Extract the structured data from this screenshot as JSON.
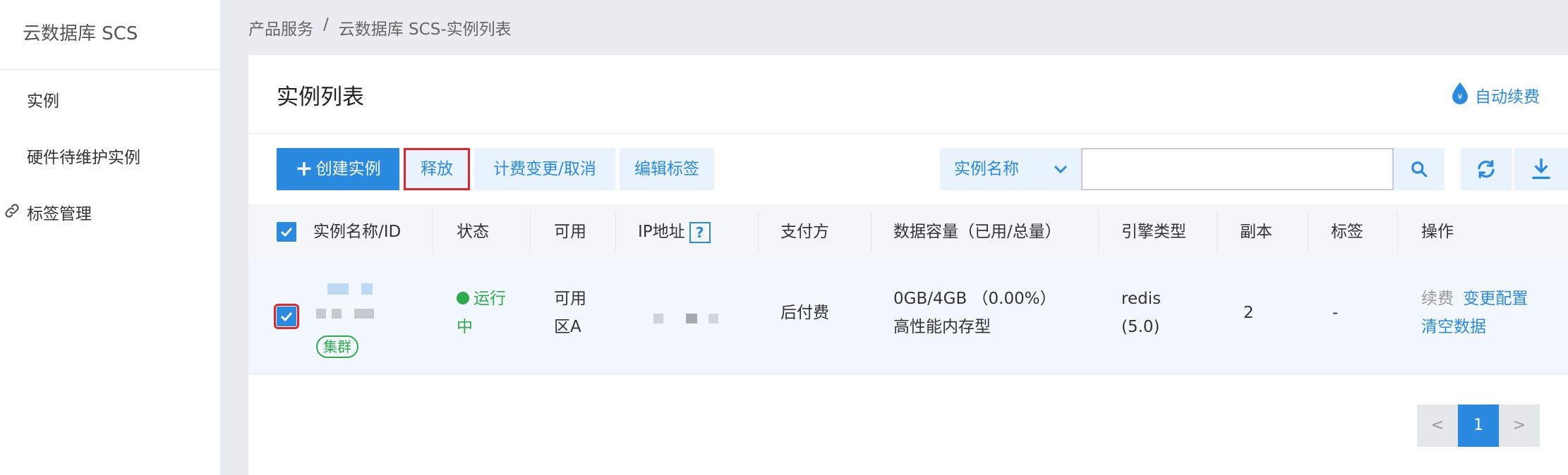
{
  "sidebar": {
    "title": "云数据库 SCS",
    "items": [
      {
        "label": "实例"
      },
      {
        "label": "硬件待维护实例"
      },
      {
        "label": "标签管理"
      }
    ]
  },
  "breadcrumb": {
    "root": "产品服务",
    "sep": "/",
    "current": "云数据库 SCS-实例列表"
  },
  "page": {
    "title": "实例列表",
    "auto_renew": "自动续费"
  },
  "toolbar": {
    "create": "创建实例",
    "release": "释放",
    "billing_change": "计费变更/取消",
    "edit_tags": "编辑标签",
    "search_field": "实例名称",
    "search_value": ""
  },
  "table": {
    "headers": [
      "实例名称/ID",
      "状态",
      "可用",
      "IP地址",
      "支付方",
      "数据容量（已用/总量）",
      "引擎类型",
      "副本",
      "标签",
      "操作"
    ],
    "help": "?",
    "rows": [
      {
        "badge": "集群",
        "status": "运行中",
        "zone": "可用区A",
        "payment": "后付费",
        "capacity": "0GB/4GB （0.00%）",
        "storage_type": "高性能内存型",
        "engine": "redis",
        "engine_version": "(5.0)",
        "replicas": "2",
        "tags": "-",
        "actions": {
          "renew": "续费",
          "change_config": "变更配置",
          "clear_data": "清空数据"
        }
      }
    ]
  },
  "pagination": {
    "prev": "<",
    "current": "1",
    "next": ">"
  },
  "colors": {
    "accent": "#2a8ae0",
    "success": "#2eaa4a",
    "highlight": "#e0262c"
  }
}
